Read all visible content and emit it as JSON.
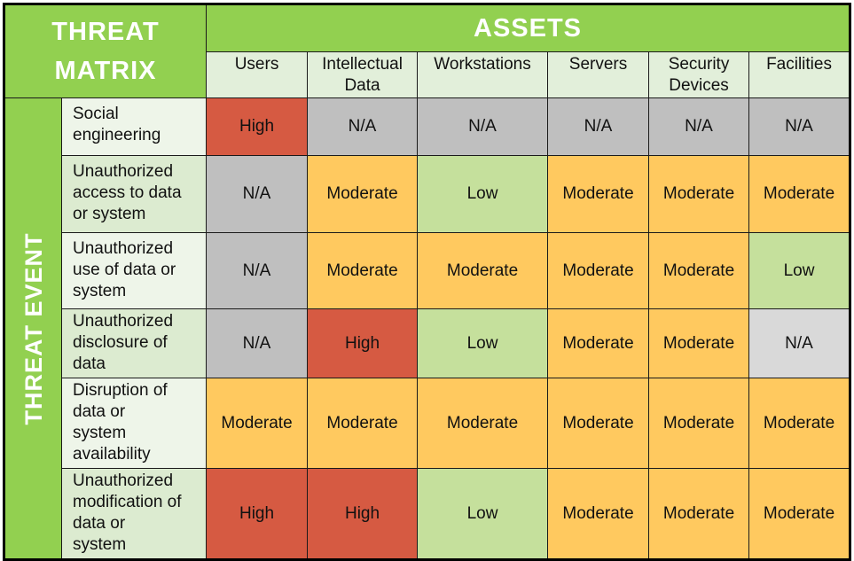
{
  "title_line1": "THREAT",
  "title_line2": "MATRIX",
  "assets_header": "ASSETS",
  "threat_event_header": "THREAT EVENT",
  "assets": [
    {
      "line1": "Users",
      "line2": ""
    },
    {
      "line1": "Intellectual",
      "line2": "Data"
    },
    {
      "line1": "Workstations",
      "line2": ""
    },
    {
      "line1": "Servers",
      "line2": ""
    },
    {
      "line1": "Security",
      "line2": "Devices"
    },
    {
      "line1": "Facilities",
      "line2": ""
    }
  ],
  "level_colors": {
    "High": "#d65a42",
    "Moderate": "#ffc95f",
    "Low": "#c5e09c",
    "N/A": "#bfbfbf"
  },
  "rows": [
    {
      "event": "Social engineering",
      "lines": [
        "Social",
        "engineering"
      ],
      "values": [
        "High",
        "N/A",
        "N/A",
        "N/A",
        "N/A",
        "N/A"
      ]
    },
    {
      "event": "Unauthorized access to data or system",
      "lines": [
        "Unauthorized",
        "access to data",
        "or system"
      ],
      "values": [
        "N/A",
        "Moderate",
        "Low",
        "Moderate",
        "Moderate",
        "Moderate"
      ]
    },
    {
      "event": "Unauthorized use of data or system",
      "lines": [
        "Unauthorized",
        "use of data or",
        "system"
      ],
      "values": [
        "N/A",
        "Moderate",
        "Moderate",
        "Moderate",
        "Moderate",
        "Low"
      ]
    },
    {
      "event": "Unauthorized disclosure of data",
      "lines": [
        "Unauthorized",
        "disclosure of",
        "data"
      ],
      "values": [
        "N/A",
        "High",
        "Low",
        "Moderate",
        "Moderate",
        "N/A"
      ]
    },
    {
      "event": "Disruption of data or system availability",
      "lines": [
        "Disruption of",
        "data or",
        "system",
        "availability"
      ],
      "values": [
        "Moderate",
        "Moderate",
        "Moderate",
        "Moderate",
        "Moderate",
        "Moderate"
      ]
    },
    {
      "event": "Unauthorized modification of data or system",
      "lines": [
        "Unauthorized",
        "modification of",
        "data or",
        "system"
      ],
      "values": [
        "High",
        "High",
        "Low",
        "Moderate",
        "Moderate",
        "Moderate"
      ]
    }
  ]
}
